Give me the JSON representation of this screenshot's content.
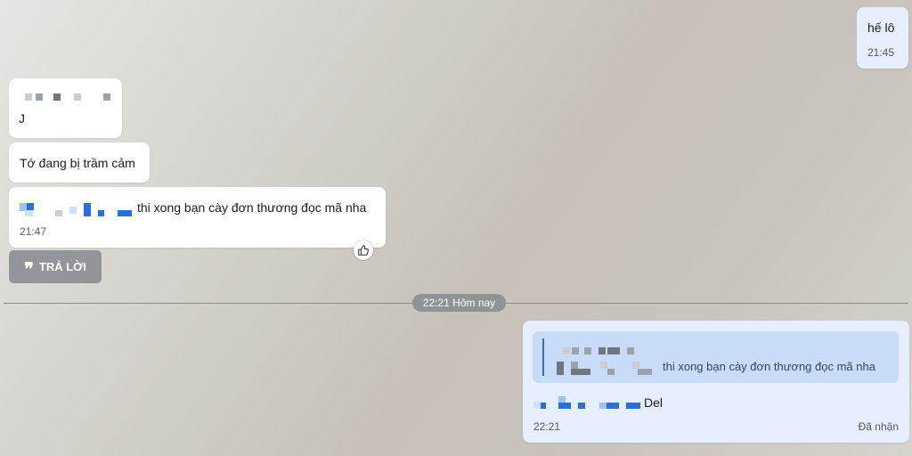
{
  "messages": {
    "helo": {
      "text": "hế lô",
      "time": "21:45"
    },
    "blur1": {
      "text": "J"
    },
    "sad": {
      "text": "Tớ đang bị trầm cảm"
    },
    "long": {
      "text": "thi xong bạn cày đơn thương đọc mã nha",
      "time": "21:47"
    }
  },
  "reply_button": {
    "label": "TRẢ LỜI"
  },
  "divider": {
    "label": "22:21 Hôm nay"
  },
  "reply_message": {
    "quote_text": "thi xong bạn cày đơn thương đọc mã nha",
    "text": "Del",
    "time": "22:21",
    "status": "Đã nhận"
  },
  "icons": {
    "like": "thumbs-up-icon",
    "quote": "quote-icon"
  },
  "colors": {
    "accent": "#2b6fd6",
    "my_bubble": "#e5efff",
    "quote_bg": "#c8dcf9"
  }
}
